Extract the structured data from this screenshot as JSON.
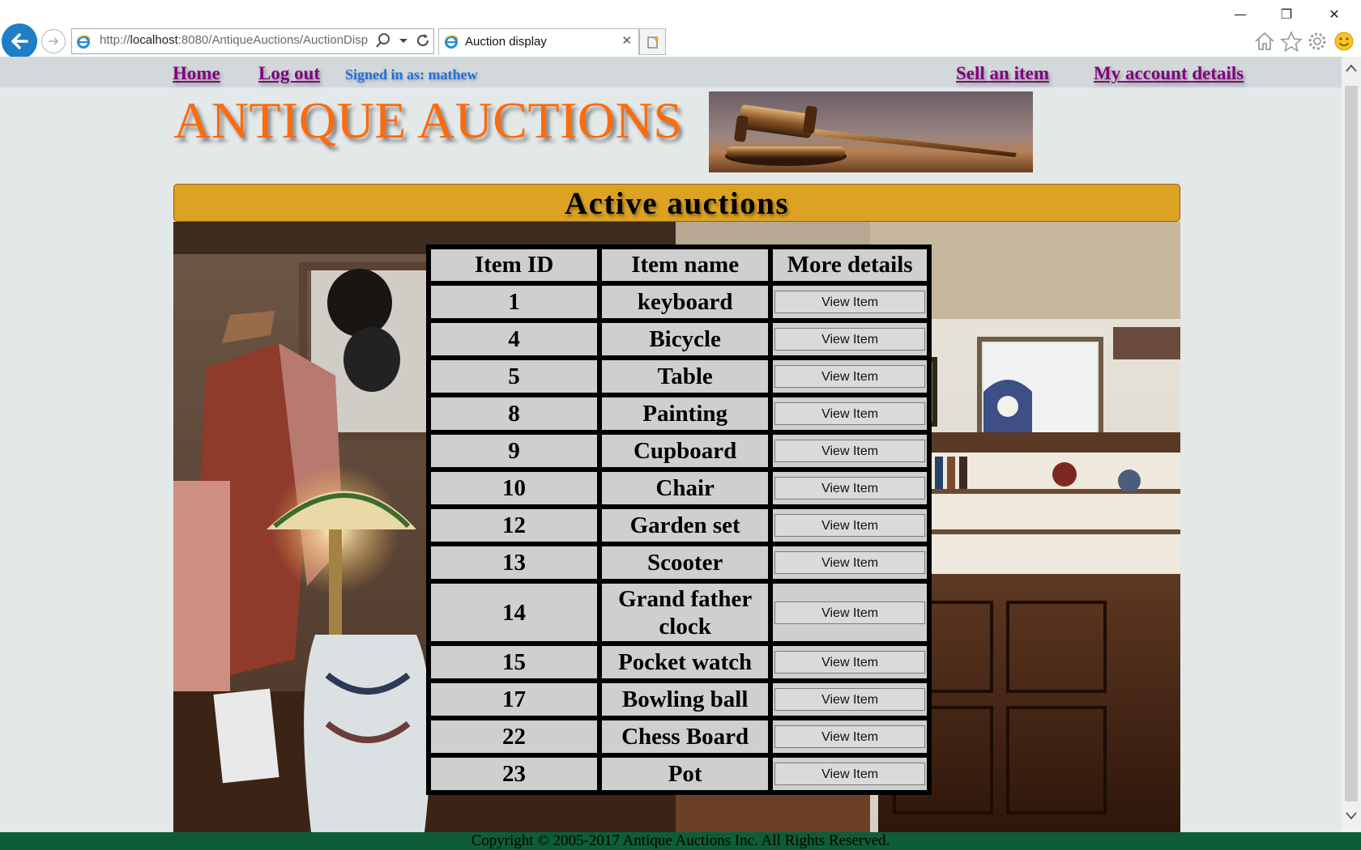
{
  "window": {
    "minimize_glyph": "—",
    "restore_glyph": "❐",
    "close_glyph": "✕"
  },
  "browser": {
    "url_prefix": "http://",
    "url_host": "localhost",
    "url_rest": ":8080/AntiqueAuctions/AuctionDisp",
    "tab_title": "Auction display",
    "tab_close": "✕",
    "toolbar_icons": [
      "home-icon",
      "favorites-star-icon",
      "settings-gear-icon",
      "feedback-smiley-icon"
    ]
  },
  "nav": {
    "home": "Home",
    "logout": "Log out",
    "signed_in": "Signed in as: mathew",
    "sell": "Sell an item",
    "account": "My account details"
  },
  "brand": {
    "title": "ANTIQUE AUCTIONS"
  },
  "heading": "Active auctions",
  "table": {
    "headers": [
      "Item ID",
      "Item name",
      "More details"
    ],
    "button_label": "View Item",
    "rows": [
      {
        "id": "1",
        "name": "keyboard"
      },
      {
        "id": "4",
        "name": "Bicycle"
      },
      {
        "id": "5",
        "name": "Table"
      },
      {
        "id": "8",
        "name": "Painting"
      },
      {
        "id": "9",
        "name": "Cupboard"
      },
      {
        "id": "10",
        "name": "Chair"
      },
      {
        "id": "12",
        "name": "Garden set"
      },
      {
        "id": "13",
        "name": "Scooter"
      },
      {
        "id": "14",
        "name": "Grand father clock"
      },
      {
        "id": "15",
        "name": "Pocket watch"
      },
      {
        "id": "17",
        "name": "Bowling ball"
      },
      {
        "id": "22",
        "name": "Chess Board"
      },
      {
        "id": "23",
        "name": "Pot"
      }
    ]
  },
  "footer": "Copyright © 2005-2017 Antique Auctions Inc. All Rights Reserved.",
  "colors": {
    "brand_orange": "#ff6a0a",
    "nav_link": "#800080",
    "signed_in_blue": "#1e6fe0",
    "heading_gold": "#dba223",
    "footer_green": "#0d5e36"
  }
}
